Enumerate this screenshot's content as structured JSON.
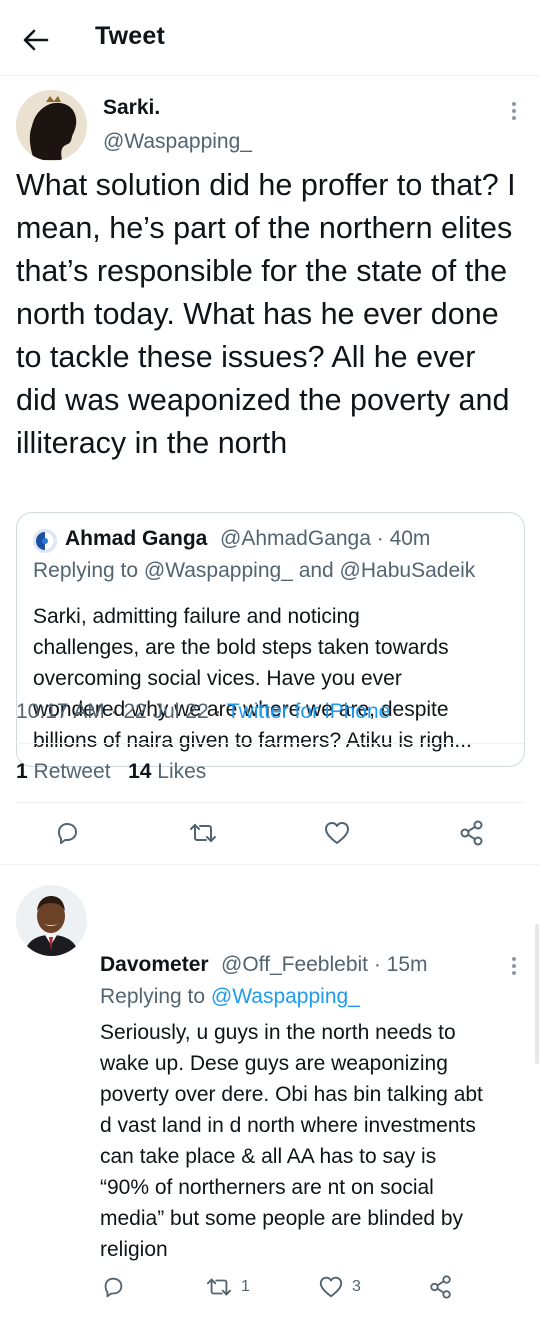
{
  "header": {
    "title": "Tweet",
    "back_icon": "arrow-left-icon"
  },
  "main_tweet": {
    "author_name": "Sarki.",
    "author_handle": "@Waspapping_",
    "text": "What solution did he proffer to that? I mean, he’s part of the northern elites that’s responsible for the state of the north today. What has he ever done to tackle these issues? All he ever did was weaponized the poverty and illiteracy in the north",
    "quote": {
      "author_name": "Ahmad Ganga",
      "meta": "@AhmadGanga · 40m",
      "replying": "Replying to @Waspapping_ and @HabuSadeik",
      "text_lines": [
        "Sarki, admitting failure and noticing",
        "challenges, are the bold steps taken towards",
        "overcoming social vices. Have you ever",
        "wondered why we are where we are, despite",
        "billions of naira given to farmers? Atiku is righ..."
      ]
    },
    "time": "10:17 AM · 22 Jul 22 · ",
    "source": "Twitter for iPhone",
    "stats": {
      "retweets_count": "1",
      "retweets_label": " Retweet",
      "likes_count": "14",
      "likes_label": " Likes"
    }
  },
  "reply": {
    "author_name": "Davometer",
    "meta": "@Off_Feeblebit · 15m",
    "replying_prefix": "Replying to ",
    "replying_mention": "@Waspapping_",
    "text_lines": [
      "Seriously, u guys in the north needs to",
      "wake up. Dese guys are weaponizing",
      "poverty over dere. Obi has bin talking abt",
      "d vast land in d north where investments",
      "can take place & all AA has to say is",
      "“90% of northerners are nt on social",
      "media” but some people are blinded by",
      "religion"
    ],
    "retweet_count": "1",
    "like_count": "3"
  },
  "colors": {
    "text": "#0f1419",
    "secondary": "#536471",
    "link": "#1d9bf0",
    "border": "#cfd9de",
    "divider": "#eff3f4"
  }
}
